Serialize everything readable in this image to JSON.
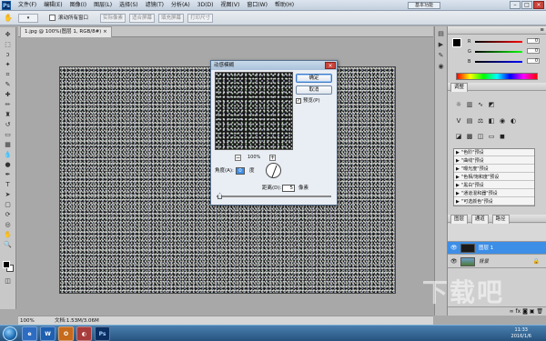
{
  "app": {
    "logo": "Ps"
  },
  "menu": {
    "items": [
      "文件(F)",
      "编辑(E)",
      "图像(I)",
      "图层(L)",
      "选择(S)",
      "滤镜(T)",
      "分析(A)",
      "3D(D)",
      "视图(V)",
      "窗口(W)",
      "帮助(H)"
    ]
  },
  "topbar": {
    "workspace_btn": "基本功能",
    "win_min": "–",
    "win_max": "□",
    "win_close": "×"
  },
  "options": {
    "scroll_all": "滚动所有窗口",
    "actual_pixels": "实际像素",
    "fit_screen": "适合屏幕",
    "fill_screen": "填充屏幕",
    "print_size": "打印尺寸"
  },
  "document": {
    "tab_title": "1.jpg @ 100%(图层 1, RGB/8#) ×",
    "zoom": "100%",
    "doc_info": "文档:1.53M/3.06M"
  },
  "dialog": {
    "title": "动感模糊",
    "ok": "确定",
    "cancel": "取消",
    "preview_label": "预览(P)",
    "preview_checked": "✓",
    "zoom_out": "−",
    "zoom_in": "+",
    "zoom": "100%",
    "angle_label": "角度(A):",
    "angle_value": "0",
    "angle_unit": "度",
    "distance_label": "距离(D):",
    "distance_value": "5",
    "distance_unit": "像素"
  },
  "color_panel": {
    "rows": [
      {
        "label": "R",
        "value": "0",
        "color": "#d13b3b"
      },
      {
        "label": "G",
        "value": "0",
        "color": "#3bb34a"
      },
      {
        "label": "B",
        "value": "0",
        "color": "#3b5fd1"
      }
    ]
  },
  "adjustments_panel": {
    "tab": "调整",
    "presets": [
      "\"色阶\"预设",
      "\"曲线\"预设",
      "\"曝光度\"预设",
      "\"色相/饱和度\"预设",
      "\"黑白\"预设",
      "\"通道混和器\"预设",
      "\"可选颜色\"预设"
    ]
  },
  "layers_panel": {
    "tabs": [
      "图层",
      "通道",
      "路径"
    ],
    "layers": [
      {
        "name": "图层 1",
        "selected": true,
        "thumb_color": "#1a1a1a"
      },
      {
        "name": "背景",
        "selected": false,
        "thumb_color": "#4c7a3a",
        "lock": "🔒"
      }
    ]
  },
  "taskbar": {
    "apps": [
      "e",
      "W",
      "O",
      "◐",
      "Ps"
    ],
    "time": "11:33",
    "date": "2016/1/6"
  },
  "watermark": "下载吧"
}
